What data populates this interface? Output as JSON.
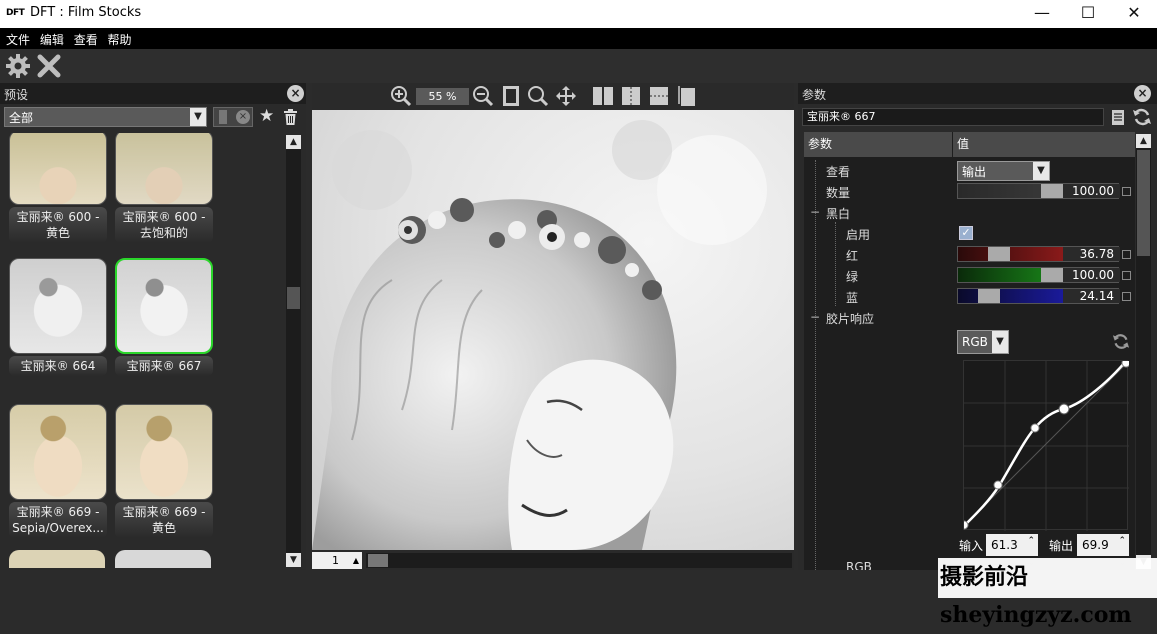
{
  "window": {
    "logo": "DFT",
    "title": "DFT : Film Stocks",
    "minimize": "—",
    "maximize": "☐",
    "close": "✕"
  },
  "menu": [
    "文件",
    "编辑",
    "查看",
    "帮助"
  ],
  "toolbar": {
    "settings_icon": "gear-icon",
    "close_icon": "x-icon"
  },
  "presets_panel": {
    "title": "预设",
    "filter_value": "全部",
    "thumbs": [
      {
        "label": "宝丽来® 600 - 黄色",
        "tone": "warm"
      },
      {
        "label": "宝丽来® 600 - 去饱和的",
        "tone": "warm"
      },
      {
        "label": "宝丽来® 664",
        "tone": "mono"
      },
      {
        "label": "宝丽来® 667",
        "tone": "mono",
        "selected": true
      },
      {
        "label": "宝丽来® 669 - Sepia/Overex...",
        "tone": "warm"
      },
      {
        "label": "宝丽来® 669 - 黄色",
        "tone": "warm"
      }
    ]
  },
  "viewer": {
    "zoom": "55 %",
    "page": "1"
  },
  "params_panel": {
    "title": "参数",
    "preset_name": "宝丽来® 667",
    "col_param": "参数",
    "col_value": "值",
    "view_label": "查看",
    "view_value": "输出",
    "amount_label": "数量",
    "amount_value": "100.00",
    "amount_fraction": 1.0,
    "bw_label": "黑白",
    "enable_label": "启用",
    "enable_checked": true,
    "red_label": "红",
    "red_value": "36.78",
    "green_label": "绿",
    "green_value": "100.00",
    "blue_label": "蓝",
    "blue_value": "24.14",
    "film_response_label": "胶片响应",
    "channel_value": "RGB",
    "input_label": "输入",
    "input_value": "61.3",
    "output_label": "输出",
    "output_value": "69.9",
    "partial_row_label": "RGB"
  },
  "watermark": "摄影前沿 sheyingzyz.com",
  "colors": {
    "selected_border": "#2bd62b",
    "red": "#8a1a1a",
    "green": "#1a8a1a",
    "blue": "#1a1a9a"
  }
}
